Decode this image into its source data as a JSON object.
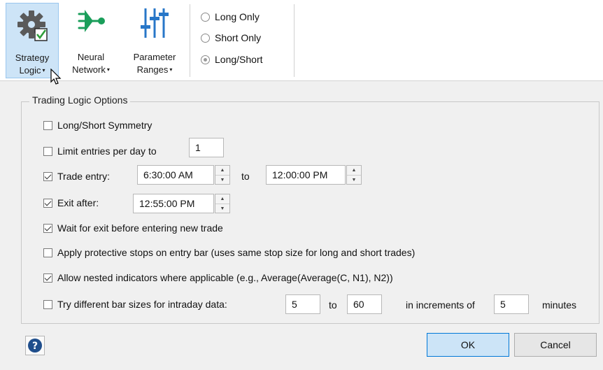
{
  "ribbon": {
    "strategy_logic": {
      "line1": "Strategy",
      "line2": "Logic",
      "icon": "gear-check-icon"
    },
    "neural_network": {
      "line1": "Neural",
      "line2": "Network",
      "icon": "neural-network-icon"
    },
    "parameter_ranges": {
      "line1": "Parameter",
      "line2": "Ranges",
      "icon": "sliders-icon"
    },
    "caret": "▾",
    "positions": [
      {
        "label": "Long Only",
        "checked": false
      },
      {
        "label": "Short Only",
        "checked": false
      },
      {
        "label": "Long/Short",
        "checked": true
      }
    ]
  },
  "trading_logic": {
    "legend": "Trading Logic Options",
    "long_short_symmetry": {
      "label": "Long/Short Symmetry",
      "checked": false
    },
    "limit_entries": {
      "label": "Limit entries per day to",
      "checked": false,
      "value": "1"
    },
    "trade_entry": {
      "label": "Trade entry:",
      "checked": true,
      "start": "6:30:00 AM",
      "to": "to",
      "end": "12:00:00 PM"
    },
    "exit_after": {
      "label": "Exit after:",
      "checked": true,
      "value": "12:55:00 PM"
    },
    "wait_for_exit": {
      "label": "Wait for exit before entering new trade",
      "checked": true
    },
    "protective_stops": {
      "label": "Apply protective stops on entry bar (uses same stop size for long and short trades)",
      "checked": false
    },
    "nested_indicators": {
      "label": "Allow nested indicators where applicable (e.g., Average(Average(C, N1), N2))",
      "checked": true
    },
    "bar_sizes": {
      "label": "Try different bar sizes for intraday data:",
      "checked": false,
      "from": "5",
      "to": "to",
      "max": "60",
      "increments": "in increments of",
      "step": "5",
      "unit": "minutes"
    }
  },
  "footer": {
    "help": "?",
    "ok": "OK",
    "cancel": "Cancel"
  }
}
